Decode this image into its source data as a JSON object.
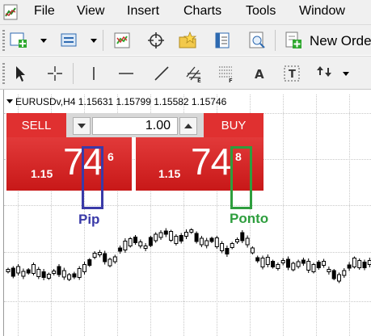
{
  "menu": {
    "items": [
      "File",
      "View",
      "Insert",
      "Charts",
      "Tools",
      "Window"
    ]
  },
  "toolbar": {
    "new_order_label": "New Orde",
    "icons_row1": [
      "new-chart-icon",
      "profiles-icon",
      "auto-arrange-icon",
      "crosshair-icon",
      "favorites-icon",
      "navigator-icon",
      "strategy-tester-icon",
      "new-order-icon"
    ],
    "icons_row2": [
      "cursor-icon",
      "crosshair-tool-icon",
      "vertical-line-icon",
      "horizontal-line-icon",
      "trendline-icon",
      "equidistant-channel-icon",
      "fibonacci-icon",
      "text-icon",
      "text-label-icon",
      "arrows-icon"
    ]
  },
  "chart": {
    "symbol_info": "EURUSDv,H4  1.15631  1.15799  1.15582  1.15746"
  },
  "trade_panel": {
    "sell_label": "SELL",
    "buy_label": "BUY",
    "lot_value": "1.00",
    "sell_price": {
      "prefix": "1.15",
      "big": "74",
      "sup": "6"
    },
    "buy_price": {
      "prefix": "1.15",
      "big": "74",
      "sup": "8"
    },
    "colors": {
      "panel_red": "#e03030",
      "text": "#ffffff"
    }
  },
  "annotations": {
    "pip_label": "Pip",
    "ponto_label": "Ponto",
    "colors": {
      "pip": "#3a3aa8",
      "ponto": "#2e9e3e"
    }
  }
}
